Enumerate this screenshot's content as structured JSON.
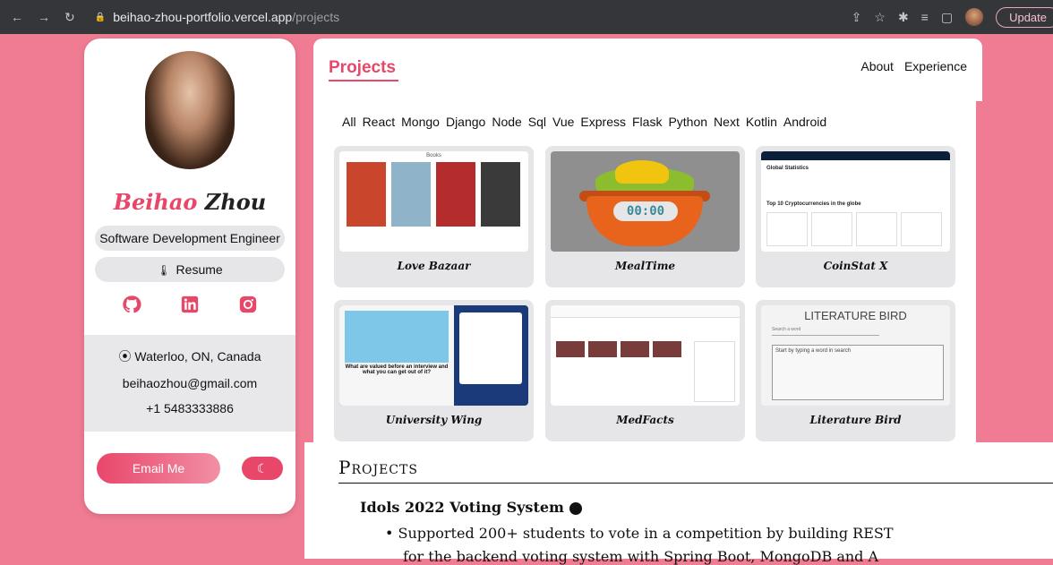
{
  "browser": {
    "url_host": "beihao-zhou-portfolio.vercel.app",
    "url_path": "/projects",
    "update_label": "Update"
  },
  "profile": {
    "first_name": "Beihao",
    "last_name": "Zhou",
    "role": "Software Development Engineer",
    "resume_label": "Resume",
    "location": "Waterloo, ON, Canada",
    "email": "beihaozhou@gmail.com",
    "phone": "+1 5483333886",
    "email_button": "Email Me",
    "socials": [
      "github-icon",
      "linkedin-icon",
      "instagram-icon"
    ]
  },
  "projects_page": {
    "heading": "Projects",
    "nav": [
      "About",
      "Experience"
    ],
    "filters": [
      "All",
      "React",
      "Mongo",
      "Django",
      "Node",
      "Sql",
      "Vue",
      "Express",
      "Flask",
      "Python",
      "Next",
      "Kotlin",
      "Android"
    ],
    "cards": [
      {
        "title": "Love Bazaar"
      },
      {
        "title": "MealTime"
      },
      {
        "title": "CoinStat X"
      },
      {
        "title": "University Wing"
      },
      {
        "title": "MedFacts"
      },
      {
        "title": "Literature Bird"
      }
    ],
    "thumbs": {
      "books_label": "Books",
      "meal_timer": "00:00",
      "coin_global": "Global Statistics",
      "coin_top": "Top 10 Cryptocurrencies in the globe",
      "uni_caption": "What are valued before an interview and what you can get out of it?",
      "lit_title": "LITERATURE BIRD",
      "lit_input": "Search a word",
      "lit_area": "Start by typing a word in search"
    }
  },
  "resume_doc": {
    "section": "Projects",
    "project": "Idols 2022 Voting System",
    "bullet1": "• Supported 200+ students to vote in a competition by building REST",
    "bullet2": "for the backend voting system with Spring Boot, MongoDB and A"
  },
  "colors": {
    "accent": "#e8476a",
    "background": "#f07c93"
  }
}
